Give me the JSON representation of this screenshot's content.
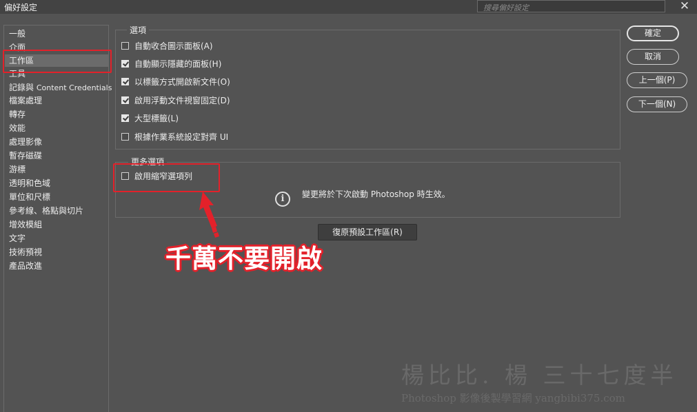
{
  "window": {
    "title": "偏好設定",
    "search_placeholder": "搜尋偏好設定",
    "close_glyph": "✕"
  },
  "sidebar": {
    "items": [
      {
        "label": "一般"
      },
      {
        "label": "介面"
      },
      {
        "label": "工作區",
        "selected": true
      },
      {
        "label": "工具"
      },
      {
        "label": "記錄與",
        "suffix": "Content Credentials"
      },
      {
        "label": "檔案處理"
      },
      {
        "label": "轉存"
      },
      {
        "label": "效能"
      },
      {
        "label": "處理影像"
      },
      {
        "label": "暫存磁碟"
      },
      {
        "label": "游標"
      },
      {
        "label": "透明和色域"
      },
      {
        "label": "單位和尺標"
      },
      {
        "label": "參考線、格點與切片"
      },
      {
        "label": "增效模組"
      },
      {
        "label": "文字"
      },
      {
        "label": "技術預視"
      },
      {
        "label": "產品改進"
      }
    ]
  },
  "options": {
    "legend": "選項",
    "items": [
      {
        "label": "自動收合圖示面板(A)",
        "checked": false
      },
      {
        "label": "自動顯示隱藏的面板(H)",
        "checked": true
      },
      {
        "label": "以標籤方式開啟新文件(O)",
        "checked": true
      },
      {
        "label": "啟用浮動文件視窗固定(D)",
        "checked": true
      },
      {
        "label": "大型標籤(L)",
        "checked": true
      },
      {
        "label": "根據作業系統設定對齊 UI",
        "checked": false
      }
    ]
  },
  "more_options": {
    "legend": "更多選項",
    "narrow_options_bar": {
      "label": "啟用縮窄選項列",
      "checked": false
    },
    "info_icon_glyph": "i",
    "info_text": "變更將於下次啟動 Photoshop 時生效。"
  },
  "restore_button": "復原預設工作區(R)",
  "buttons": {
    "ok": "確定",
    "cancel": "取消",
    "prev": "上一個(P)",
    "next": "下一個(N)"
  },
  "annotation": {
    "warning_text": "千萬不要開啟",
    "accent_color": "#e3212a"
  },
  "watermark": {
    "line1": "楊比比. 楊 三十七度半",
    "line2": "Photoshop 影像後製學習網 yangbibi375.com"
  }
}
